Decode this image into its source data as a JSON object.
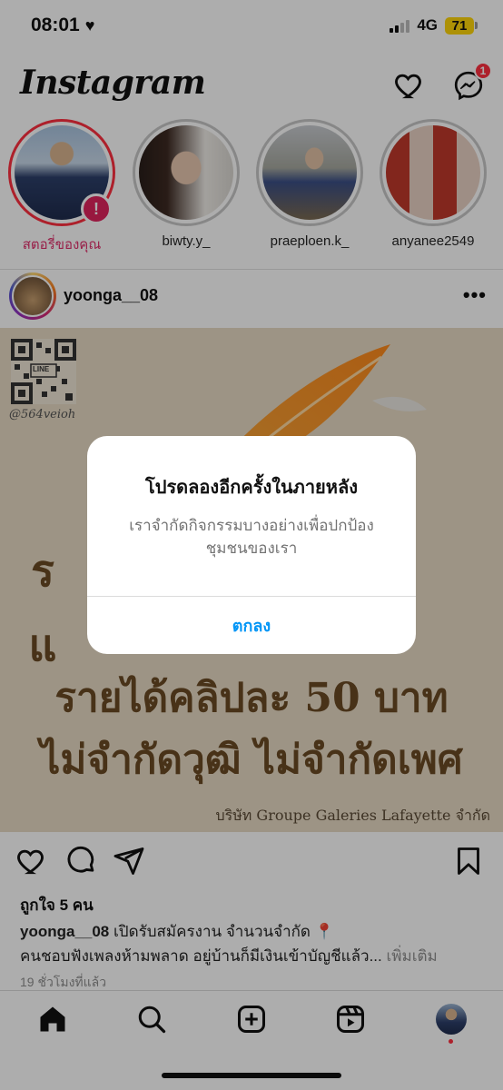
{
  "status_bar": {
    "time": "08:01",
    "network": "4G",
    "battery": "71"
  },
  "header": {
    "logo": "Instagram",
    "messenger_badge": "1"
  },
  "stories": [
    {
      "name": "สตอรี่ของคุณ",
      "own": true
    },
    {
      "name": "biwty.y_"
    },
    {
      "name": "praeploen.k_"
    },
    {
      "name": "anyanee2549"
    }
  ],
  "post": {
    "username": "yoonga__08",
    "qr_caption": "@564veioh",
    "qr_label": "LINE",
    "image_lines": [
      "ร",
      "แ",
      "รายได้คลิปละ 50 บาท",
      "ไม่จำกัดวุฒิ ไม่จำกัดเพศ"
    ],
    "image_footer": "บริษัท Groupe Galeries Lafayette จำกัด",
    "likes": "ถูกใจ 5 คน",
    "caption_user": "yoonga__08",
    "caption_line1": " เปิดรับสมัครงาน จำนวนจำกัด 📍",
    "caption_line2": "คนชอบฟังเพลงห้ามพลาด อยู่บ้านก็มีเงินเข้าบัญชีแล้ว...",
    "caption_more": " เพิ่มเติม",
    "time_ago": "19 ชั่วโมงที่แล้ว"
  },
  "dialog": {
    "title": "โปรดลองอีกครั้งในภายหลัง",
    "message": "เราจำกัดกิจกรรมบางอย่างเพื่อปกป้องชุมชนของเรา",
    "ok_button": "ตกลง"
  },
  "colors": {
    "accent_blue": "#0095f6",
    "badge_red": "#ff3040",
    "overlay": "rgba(0,0,0,0.32)",
    "post_bg": "#e7dac4"
  }
}
